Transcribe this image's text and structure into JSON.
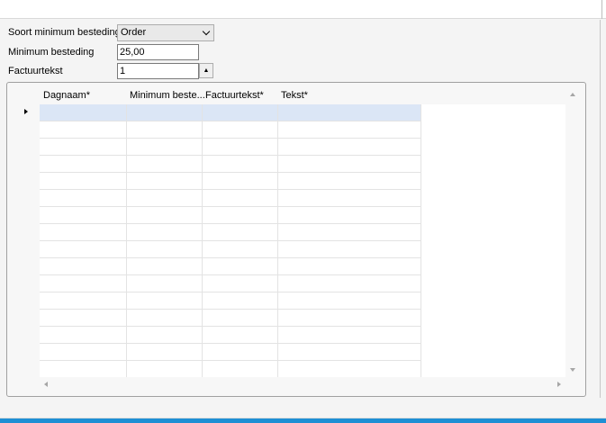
{
  "form": {
    "spend_type_label": "Soort minimum besteding",
    "spend_type_value": "Order",
    "min_spend_label": "Minimum besteding",
    "min_spend_value": "25,00",
    "invoice_text_label": "Factuurtekst",
    "invoice_text_value": "1"
  },
  "grid": {
    "columns": [
      "Dagnaam*",
      "Minimum beste...",
      "Factuurtekst*",
      "Tekst*"
    ],
    "row_count": 16,
    "selected_row": 0
  },
  "colors": {
    "selected_row": "#dbe6f6",
    "accent_bar": "#1e8fd4"
  }
}
